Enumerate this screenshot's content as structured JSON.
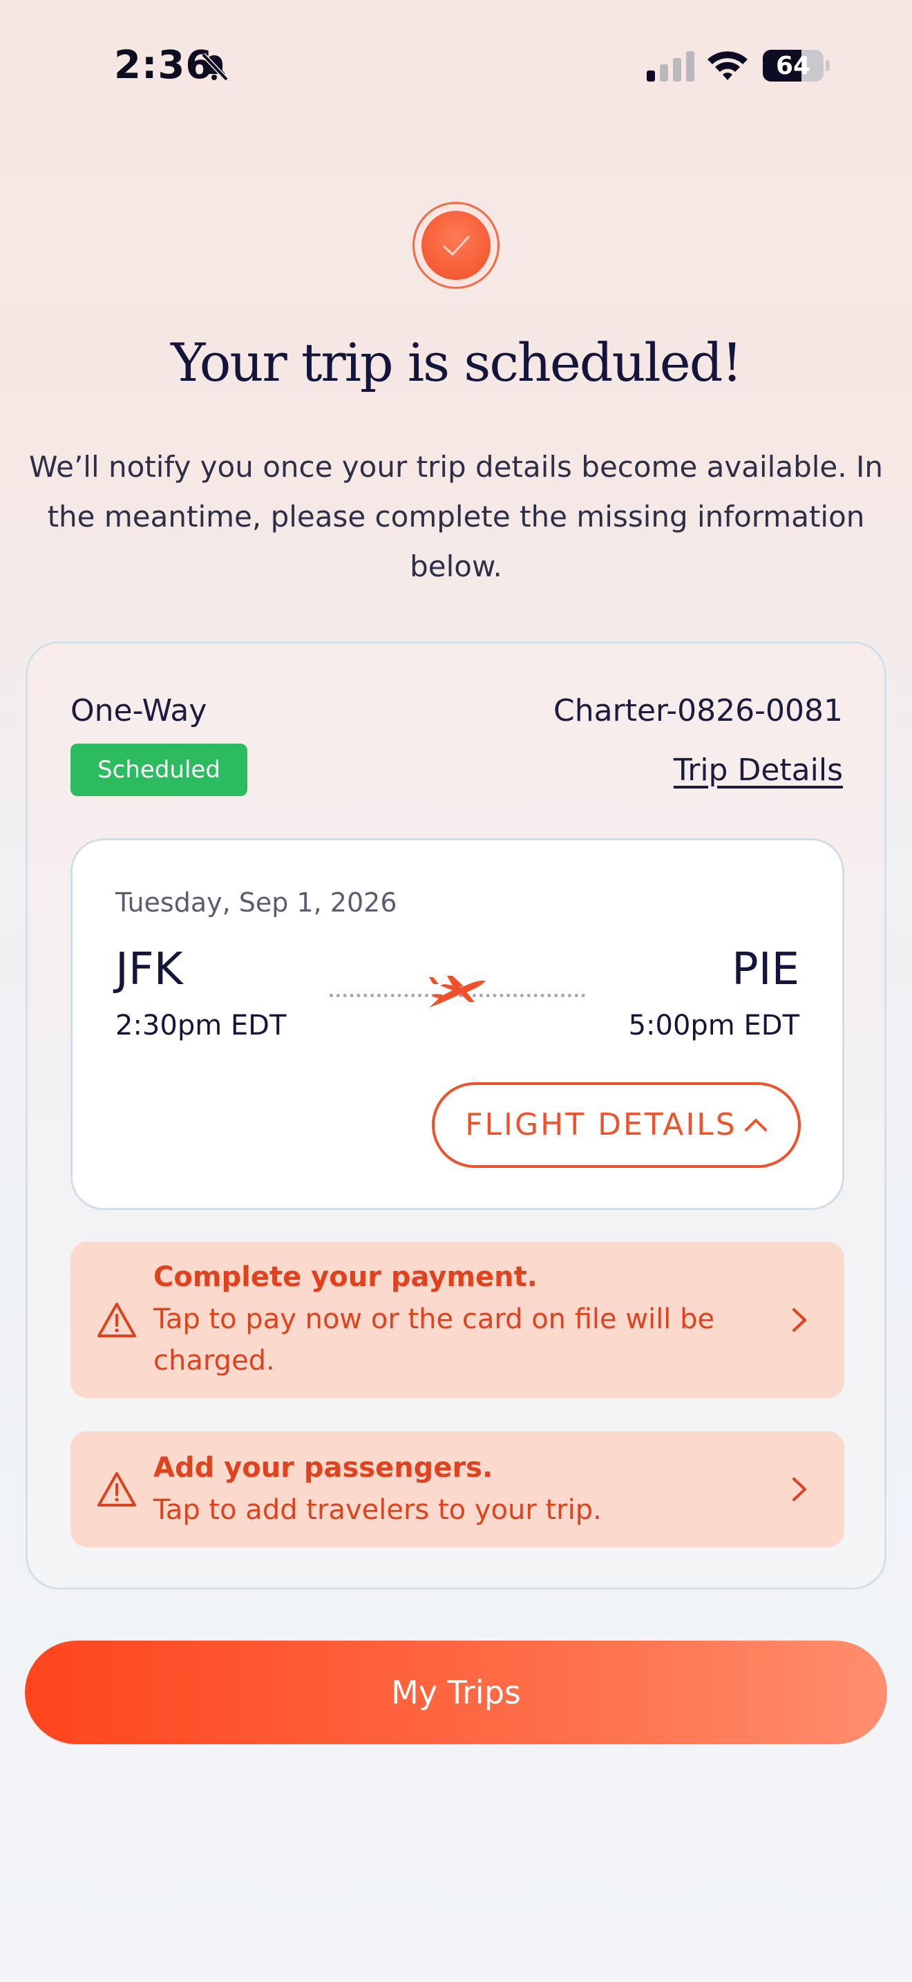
{
  "status_bar": {
    "time": "2:36",
    "battery": "64",
    "battery_level": 0.64
  },
  "header": {
    "title": "Your trip is scheduled!",
    "subtitle": "We’ll notify you once your trip details become available. In the meantime, please complete the missing information below."
  },
  "trip": {
    "type": "One-Way",
    "id": "Charter-0826-0081",
    "status": "Scheduled",
    "details_link": "Trip Details",
    "flight": {
      "date": "Tuesday, Sep 1, 2026",
      "origin_code": "JFK",
      "origin_time": "2:30pm EDT",
      "destination_code": "PIE",
      "destination_time": "5:00pm EDT",
      "details_button": "FLIGHT DETAILS"
    }
  },
  "alerts": [
    {
      "title": "Complete your payment.",
      "text": "Tap to pay now or the card on file will be charged."
    },
    {
      "title": "Add your passengers.",
      "text": "Tap to add travelers to your trip."
    }
  ],
  "footer": {
    "my_trips_button": "My Trips"
  },
  "colors": {
    "accent": "#F0502A",
    "status_green": "#2CBC5F",
    "alert_background": "#FBD9CD",
    "text_dark": "#14153A"
  }
}
